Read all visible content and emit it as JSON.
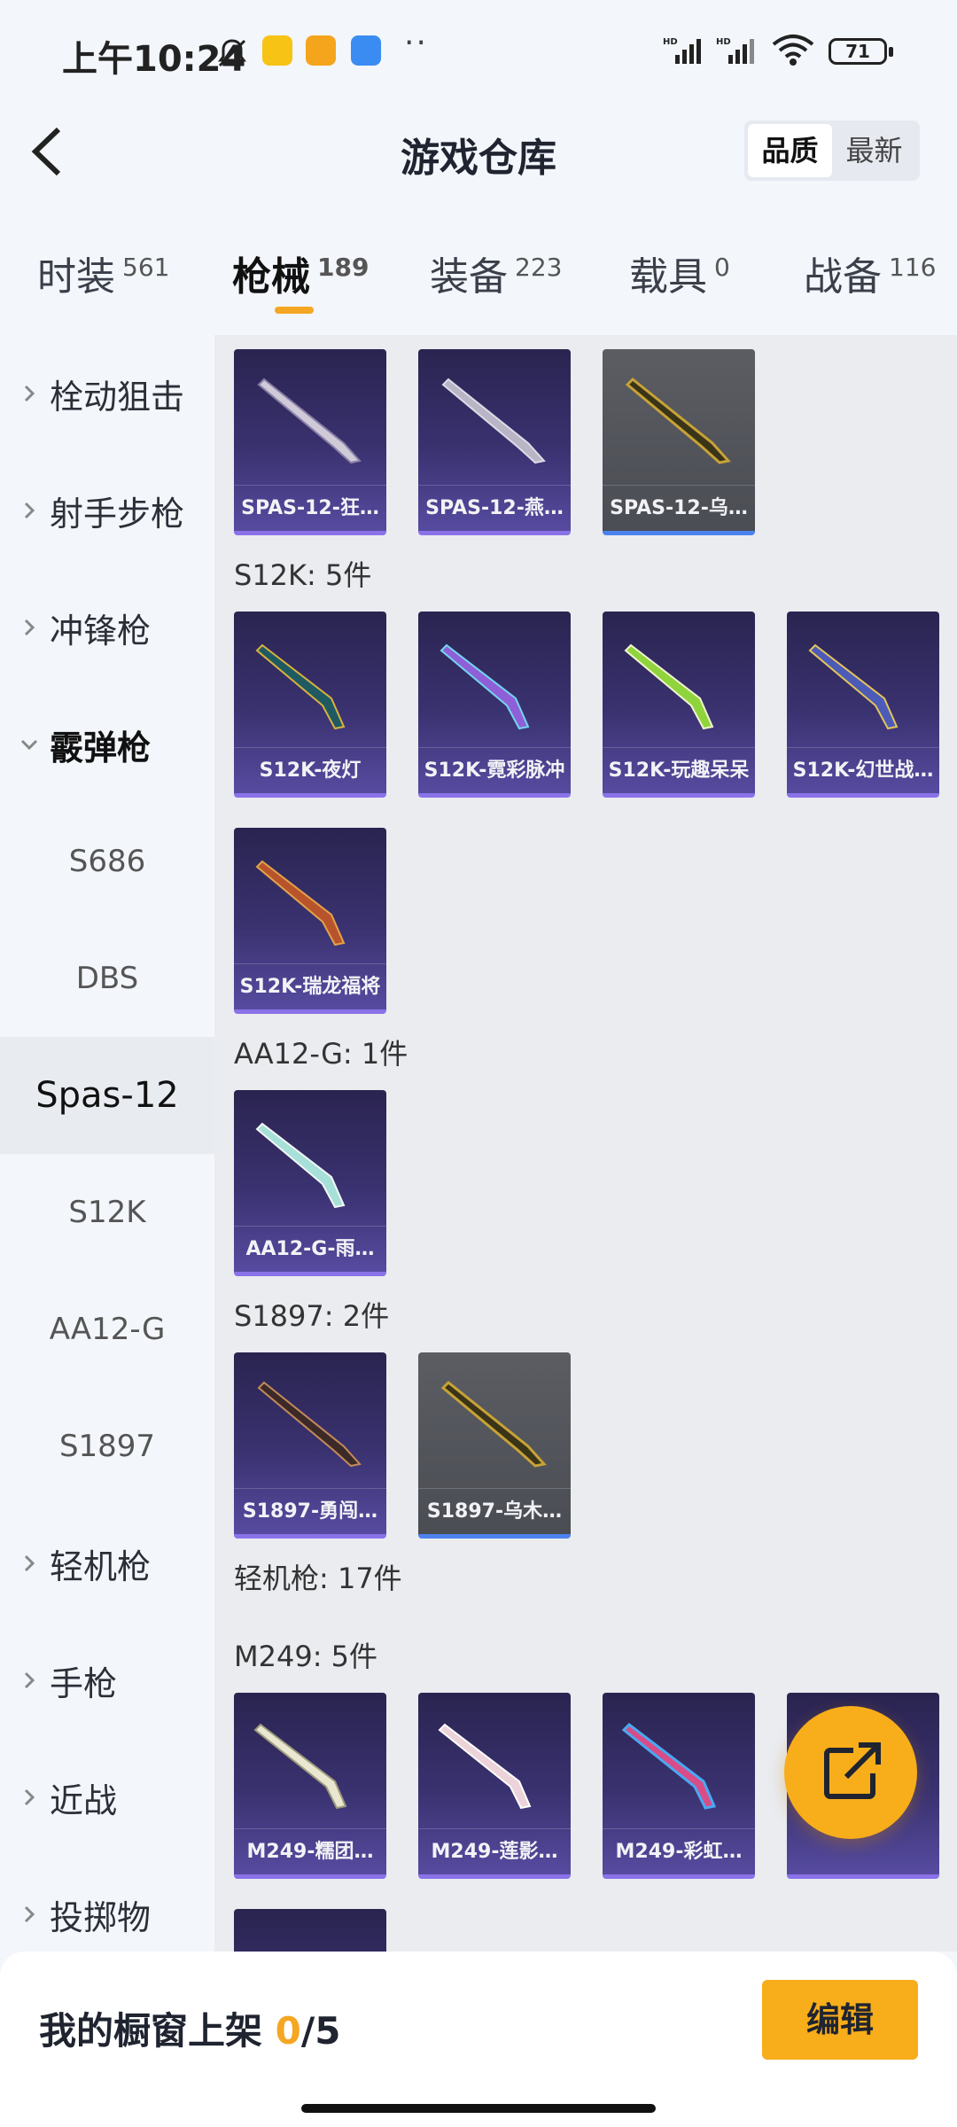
{
  "status_bar": {
    "time": "上午10:24",
    "battery": "71"
  },
  "header": {
    "title": "游戏仓库",
    "sort_options": [
      "品质",
      "最新"
    ],
    "selected_sort": "品质"
  },
  "tabs": [
    {
      "label": "时装",
      "count": "561"
    },
    {
      "label": "枪械",
      "count": "189"
    },
    {
      "label": "装备",
      "count": "223"
    },
    {
      "label": "载具",
      "count": "0"
    },
    {
      "label": "战备",
      "count": "116"
    }
  ],
  "sidebar": {
    "cat_sniper": "栓动狙击",
    "cat_marksman": "射手步枪",
    "cat_smg": "冲锋枪",
    "cat_shotgun": "霰弹枪",
    "sub_s686": "S686",
    "sub_dbs": "DBS",
    "sub_spas": "Spas-12",
    "sub_s12k": "S12K",
    "sub_aa12": "AA12-G",
    "sub_s1897": "S1897",
    "cat_lmg": "轻机枪",
    "cat_pistol": "手枪",
    "cat_melee": "近战",
    "cat_throw": "投掷物"
  },
  "content": {
    "spas_items": [
      "SPAS-12-狂…",
      "SPAS-12-燕…",
      "SPAS-12-乌…"
    ],
    "s12k_label": "S12K: 5件",
    "s12k_items": [
      "S12K-夜灯",
      "S12K-霓彩脉冲",
      "S12K-玩趣呆呆",
      "S12K-幻世战…",
      "S12K-瑞龙福将"
    ],
    "aa12_label": "AA12-G: 1件",
    "aa12_items": [
      "AA12-G-雨…"
    ],
    "s1897_label": "S1897: 2件",
    "s1897_items": [
      "S1897-勇闯…",
      "S1897-乌木…"
    ],
    "lmg_label": "轻机枪: 17件",
    "m249_label": "M249: 5件",
    "m249_items": [
      "M249-糯团…",
      "M249-莲影…",
      "M249-彩虹…"
    ]
  },
  "bottom": {
    "shelf_label": "我的橱窗上架",
    "shelf_used": "0",
    "shelf_total": "/5",
    "edit_label": "编辑"
  },
  "colors": {
    "accent": "#f5a623",
    "card_purple": "#3a3270",
    "card_grey": "#55575d"
  }
}
